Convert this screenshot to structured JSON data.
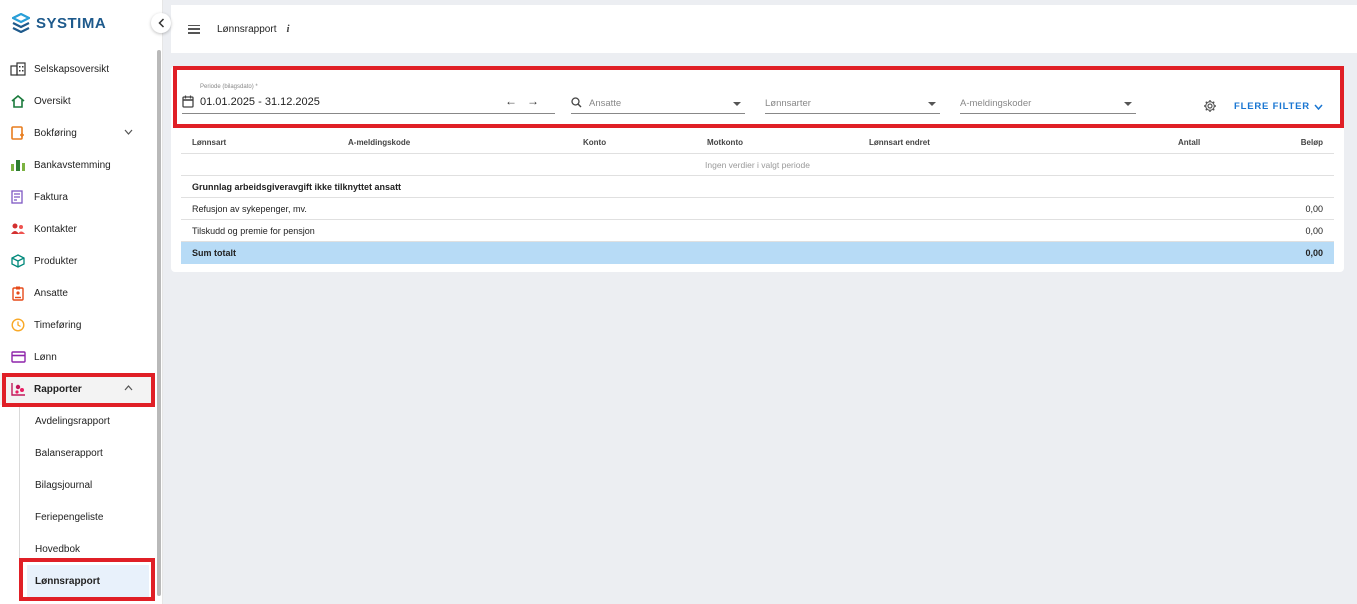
{
  "brand": {
    "name": "SYSTIMA",
    "color": "#1e5a8c"
  },
  "sidebar": {
    "items": [
      {
        "label": "Selskapsoversikt",
        "icon": "building-icon"
      },
      {
        "label": "Oversikt",
        "icon": "home-icon"
      },
      {
        "label": "Bokføring",
        "icon": "bookkeeping-icon"
      },
      {
        "label": "Bankavstemming",
        "icon": "bank-icon"
      },
      {
        "label": "Faktura",
        "icon": "invoice-icon"
      },
      {
        "label": "Kontakter",
        "icon": "contacts-icon"
      },
      {
        "label": "Produkter",
        "icon": "box-icon"
      },
      {
        "label": "Ansatte",
        "icon": "badge-icon"
      },
      {
        "label": "Timeføring",
        "icon": "clock-icon"
      },
      {
        "label": "Lønn",
        "icon": "card-icon"
      },
      {
        "label": "Rapporter",
        "icon": "report-icon"
      }
    ],
    "subitems": [
      {
        "label": "Avdelingsrapport"
      },
      {
        "label": "Balanserapport"
      },
      {
        "label": "Bilagsjournal"
      },
      {
        "label": "Feriepengeliste"
      },
      {
        "label": "Hovedbok"
      },
      {
        "label": "Lønnsrapport"
      }
    ]
  },
  "header": {
    "title": "Lønnsrapport",
    "info": "i"
  },
  "filters": {
    "period_caption": "Periode (bilagsdato) *",
    "period_value": "01.01.2025 - 31.12.2025",
    "employees_placeholder": "Ansatte",
    "pay_types_placeholder": "Lønnsarter",
    "a_codes_placeholder": "A-meldingskoder",
    "more_filter_label": "FLERE FILTER",
    "accent": "#1976d2"
  },
  "table": {
    "columns": [
      "Lønnsart",
      "A-meldingskode",
      "Konto",
      "Motkonto",
      "Lønnsart endret",
      "Antall",
      "Beløp"
    ],
    "empty_text": "Ingen verdier i valgt periode",
    "group_title": "Grunnlag arbeidsgiveravgift ikke tilknyttet ansatt",
    "rows": [
      {
        "label": "Refusjon av sykepenger, mv.",
        "amount": "0,00"
      },
      {
        "label": "Tilskudd og premie for pensjon",
        "amount": "0,00"
      }
    ],
    "total": {
      "label": "Sum totalt",
      "amount": "0,00"
    }
  }
}
